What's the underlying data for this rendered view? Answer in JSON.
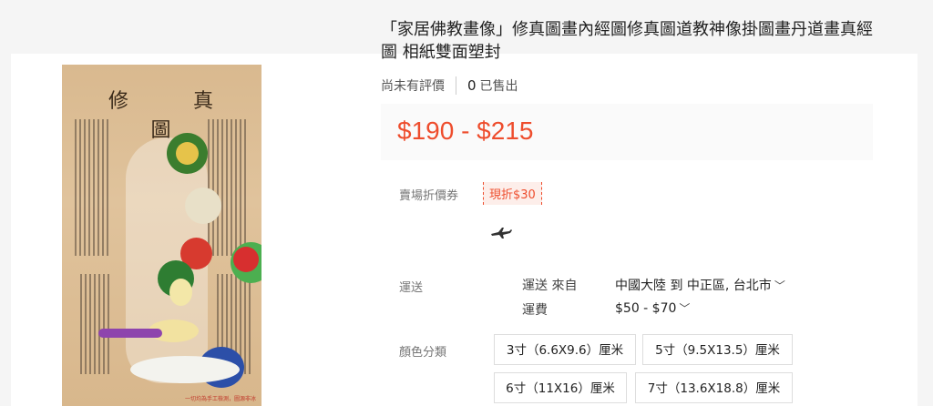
{
  "product": {
    "image_title": "修 真 圖",
    "image_watermark": "一切均為手工檢測，圖源非冰",
    "title": "「家居佛教畫像」修真圖畫內經圖修真圖道教神像掛圖畫丹道畫真經圖 相紙雙面塑封",
    "rating_text": "尚未有評價",
    "sold_count": "0",
    "sold_label": "已售出",
    "price_range": "$190 - $215"
  },
  "voucher": {
    "label": "賣場折價券",
    "tag": "現折$30"
  },
  "shipping": {
    "label": "運送",
    "from_label": "運送 來自",
    "from_value": "中國大陸 到 中正區, 台北市",
    "fee_label": "運費",
    "fee_value": "$50 - $70"
  },
  "variations": {
    "label": "顏色分類",
    "options": [
      "3寸（6.6X9.6）厘米",
      "5寸（9.5X13.5）厘米",
      "6寸（11X16）厘米",
      "7寸（13.6X18.8）厘米"
    ]
  },
  "colors": {
    "accent": "#ee4d2d",
    "price_bg": "#fafafa"
  },
  "icons": {
    "shipping": "truck-plane-icon",
    "chevron": "chevron-down-icon"
  }
}
